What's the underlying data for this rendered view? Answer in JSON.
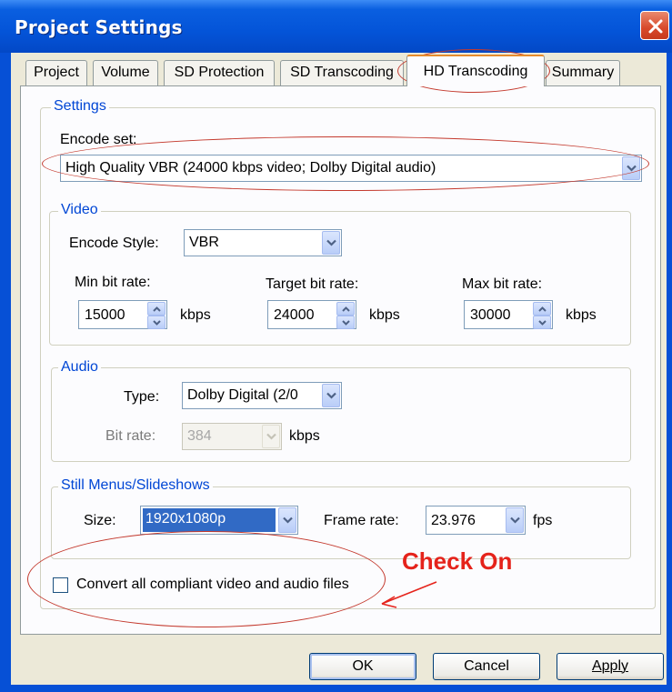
{
  "window": {
    "title": "Project Settings"
  },
  "tabs": [
    {
      "label": "Project"
    },
    {
      "label": "Volume"
    },
    {
      "label": "SD Protection"
    },
    {
      "label": "SD Transcoding"
    },
    {
      "label": "HD Transcoding",
      "active": true
    },
    {
      "label": "Summary"
    }
  ],
  "settings": {
    "legend": "Settings",
    "encode_set_label": "Encode set:",
    "encode_set_value": "High Quality VBR (24000 kbps video; Dolby Digital audio)"
  },
  "video": {
    "legend": "Video",
    "encode_style_label": "Encode Style:",
    "encode_style_value": "VBR",
    "min_label": "Min bit rate:",
    "min_value": "15000",
    "target_label": "Target bit rate:",
    "target_value": "24000",
    "max_label": "Max bit rate:",
    "max_value": "30000",
    "unit": "kbps"
  },
  "audio": {
    "legend": "Audio",
    "type_label": "Type:",
    "type_value": "Dolby Digital (2/0",
    "bitrate_label": "Bit rate:",
    "bitrate_value": "384",
    "unit": "kbps"
  },
  "still": {
    "legend": "Still Menus/Slideshows",
    "size_label": "Size:",
    "size_value": "1920x1080p",
    "frame_label": "Frame rate:",
    "frame_value": "23.976",
    "frame_unit": "fps"
  },
  "convert": {
    "label": "Convert all compliant video and audio files",
    "checked": false
  },
  "annotation": {
    "text": "Check On",
    "color": "#e5231b"
  },
  "buttons": {
    "ok": "OK",
    "cancel": "Cancel",
    "apply": "Apply"
  },
  "colors": {
    "titlebar": "#0454d8",
    "group_legend": "#0046d5",
    "annotation_ellipse": "#c43a2e"
  }
}
